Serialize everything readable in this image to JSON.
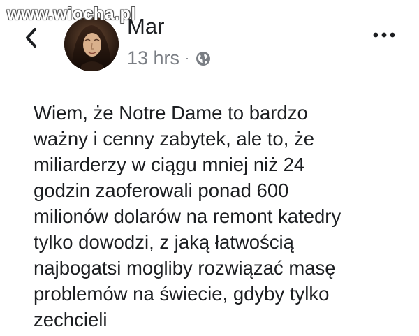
{
  "watermark": "www.wiocha.pl",
  "post": {
    "author": "Mar",
    "time": "13 hrs",
    "separator": "·",
    "privacy_icon": "globe-icon",
    "more_icon": "more-dots-icon",
    "back_icon": "chevron-left-icon",
    "text": "Wiem, że Notre Dame to bardzo\nważny i cenny zabytek, ale to, że\nmiliarderzy w ciągu mniej niż 24\ngodzin zaoferowali ponad 600\nmilionów dolarów na remont katedry\ntylko dowodzi, z jaką łatwością\nnajbogatsi mogliby rozwiązać masę\nproblemów na świecie, gdyby tylko\nzechcieli"
  },
  "colors": {
    "text": "#1c1e21",
    "meta": "#7a7e84",
    "background": "#ffffff"
  }
}
